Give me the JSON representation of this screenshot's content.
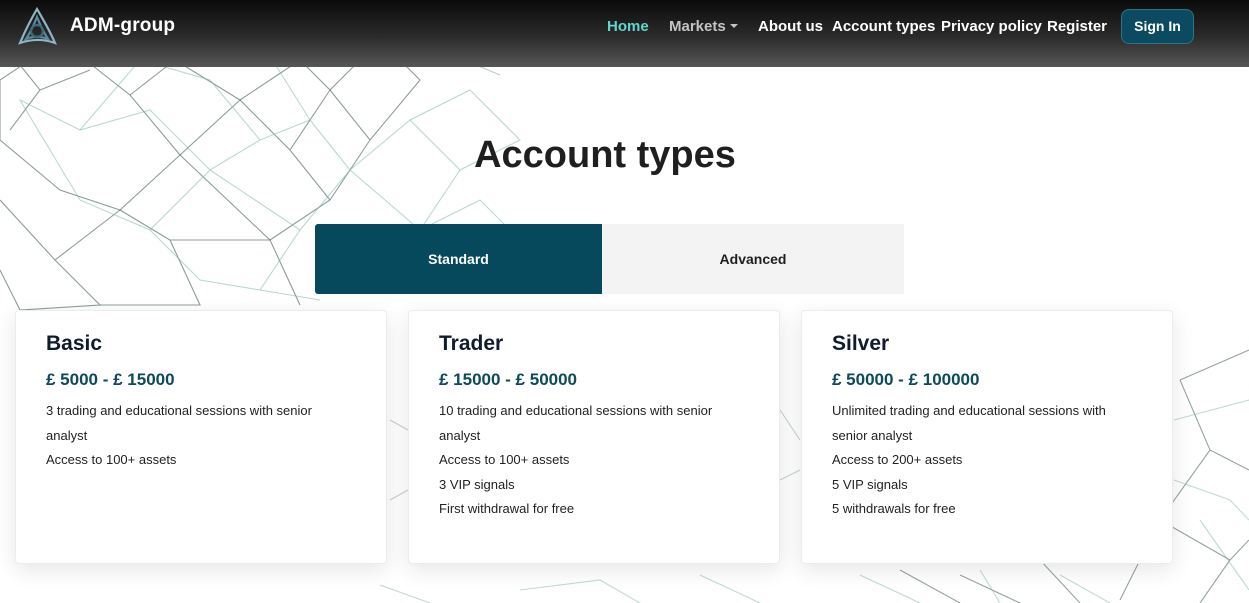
{
  "header": {
    "brand": "ADM-group",
    "nav": [
      {
        "label": "Home",
        "active": true
      },
      {
        "label": "Markets",
        "dropdown": true
      },
      {
        "label": "About us"
      },
      {
        "label": "Account types"
      },
      {
        "label": "Privacy policy"
      },
      {
        "label": "Register"
      }
    ],
    "signin_label": "Sign In"
  },
  "main": {
    "title": "Account types",
    "tabs": [
      {
        "label": "Standard",
        "selected": true
      },
      {
        "label": "Advanced",
        "selected": false
      }
    ],
    "cards": [
      {
        "title": "Basic",
        "range": "£ 5000 - £ 15000",
        "features": [
          "3 trading and educational sessions with senior analyst",
          "Access to 100+ assets"
        ]
      },
      {
        "title": "Trader",
        "range": "£ 15000 - £ 50000",
        "features": [
          "10 trading and educational sessions with senior analyst",
          "Access to 100+ assets",
          "3 VIP signals",
          "First withdrawal for free"
        ]
      },
      {
        "title": "Silver",
        "range": "£ 50000 - £ 100000",
        "features": [
          "Unlimited trading and educational sessions with senior analyst",
          "Access to 200+ assets",
          "5 VIP signals",
          "5 withdrawals for free"
        ]
      }
    ]
  },
  "colors": {
    "accent": "#06495c",
    "nav_active": "#5fd6cb",
    "price": "#0c4a5c"
  },
  "icons": {
    "logo": "triangle-knot-logo-icon",
    "markets_dropdown": "caret-down-icon",
    "background": "network-mesh-decoration"
  }
}
